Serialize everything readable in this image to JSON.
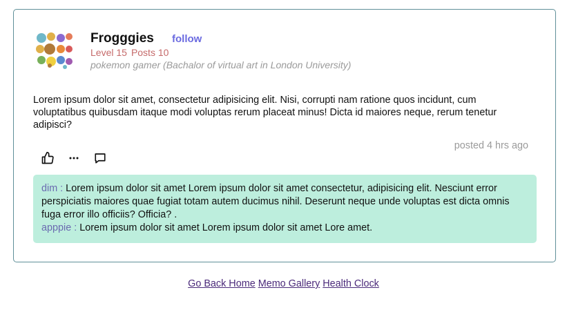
{
  "profile": {
    "username": "Frogggies",
    "follow_label": "follow",
    "level": "Level 15",
    "posts": "Posts 10",
    "bio": "pokemon gamer (Bachalor of virtual art in London University)"
  },
  "post": {
    "text": "Lorem ipsum dolor sit amet, consectetur adipisicing elit. Nisi, corrupti nam ratione quos incidunt, cum voluptatibus quibusdam itaque modi voluptas rerum placeat minus! Dicta id maiores neque, rerum tenetur adipisci?",
    "posted": "posted 4 hrs ago"
  },
  "actions": {
    "like_icon": "thumbs-up-icon",
    "more_icon": "more-icon",
    "comment_icon": "comment-icon"
  },
  "comments": [
    {
      "author": "dim :",
      "text": " Lorem ipsum dolor sit amet Lorem ipsum dolor sit amet consectetur, adipisicing elit. Nesciunt error perspiciatis maiores quae fugiat totam autem ducimus nihil. Deserunt neque unde voluptas est dicta omnis fuga error illo officiis? Officia? ."
    },
    {
      "author": "apppie :",
      "text": " Lorem ipsum dolor sit amet Lorem ipsum dolor sit amet Lore amet."
    }
  ],
  "footer": {
    "home": "Go Back Home",
    "memo": "Memo Gallery",
    "health": "Health Clock"
  },
  "colors": {
    "card_border": "#5f8f98",
    "follow": "#6a6ae0",
    "stats": "#c56a6a",
    "comments_bg": "#bdeedd",
    "comment_author": "#6a6ab0",
    "footer_link": "#4b2a7a"
  }
}
